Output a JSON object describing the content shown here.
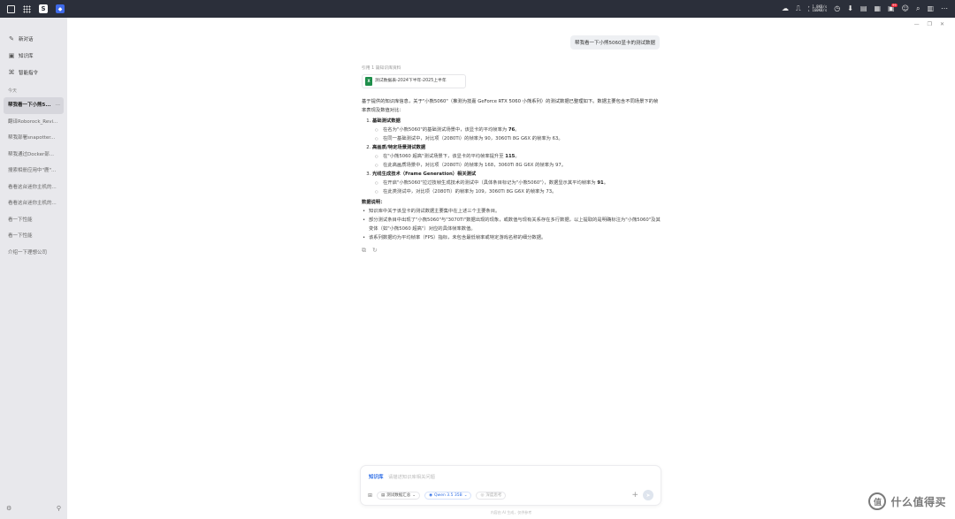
{
  "topbar": {
    "net_up": "↑ 1.8KB/s",
    "net_down": "↓ 160KB/s",
    "badge_count": "99"
  },
  "sidebar": {
    "nav": [
      {
        "label": "新对话",
        "icon": "new-chat-icon"
      },
      {
        "label": "知识库",
        "icon": "knowledge-icon"
      },
      {
        "label": "智能指令",
        "icon": "command-icon"
      }
    ],
    "section_today": "今天",
    "history": [
      {
        "label": "帮我看一下小熊5...",
        "active": true
      },
      {
        "label": "翻译Roborock_Revi..."
      },
      {
        "label": "帮我部署snapotter..."
      },
      {
        "label": "帮我通过Docker部..."
      },
      {
        "label": "搜索相册应用中\"鹿\"..."
      },
      {
        "label": "看看这台迷你主机的..."
      },
      {
        "label": "看看这台迷你主机的..."
      },
      {
        "label": "看一下性能"
      },
      {
        "label": "看一下性能"
      },
      {
        "label": "介绍一下理想公司"
      }
    ],
    "more_label": "···"
  },
  "chat": {
    "user_message": "帮我看一下小熊5060显卡的测试数据",
    "cite_label": "引用 1 篇知识库资料",
    "cite_file": "测试数据表-2024下半年-2025上半年",
    "intro": "基于提供的知识库信息，关于\"小熊5060\"（推测为技嘉 GeForce RTX 5060 小熊系列）的测试数据已整理如下。数据主要包含不同场景下的帧率表现及数值对比：",
    "sections": [
      {
        "title": "基础测试数据",
        "items": [
          {
            "pre": "在名为\"小熊5060\"的基础测试场景中，该显卡的平均帧率为 ",
            "num": "76",
            "post": "。"
          },
          {
            "pre": "在同一基础测试中，对比项（2080Ti）的帧率为 90，3060Ti 8G G6X 的帧率为 63。",
            "num": "",
            "post": ""
          }
        ]
      },
      {
        "title": "高画质/特定场景测试数据",
        "items": [
          {
            "pre": "在\"小熊5060 超高\"测试场景下，该显卡的平均帧率提升至 ",
            "num": "115",
            "post": "。"
          },
          {
            "pre": "在此高画质场景中，对比项（2080Ti）的帧率为 168，3060Ti 8G G6X 的帧率为 97。",
            "num": "",
            "post": ""
          }
        ]
      },
      {
        "title": "光线生成技术（Frame Generation）相关测试",
        "items": [
          {
            "pre": "在开启\"小熊5060\"拉过技帧生成技术的测试中（具体条目标记为\"小熊5060\"），数据显示其平均帧率为 ",
            "num": "91",
            "post": "。"
          },
          {
            "pre": "在此类测试中，对比项（2080Ti）的帧率为 109，3060Ti 8G G6X 的帧率为 73。",
            "num": "",
            "post": ""
          }
        ]
      }
    ],
    "notes_title": "数据说明：",
    "notes": [
      "知识库中关于该显卡的测试数据主要集中在上述三个主要条目。",
      "部分测试条目中出现了\"小熊5060\"与\"3070Ti\"数据出现的现象，或数值与现有关系存在多行数据，以上提取的是明确标注为\"小熊5060\"及其变体（如\"小熊5060 超高\"）对应的具体帧率数值。",
      "该系列数据均为平均帧率（FPS）指标，未包含最低帧率或特定游戏名称的细分数据。"
    ]
  },
  "input": {
    "kb_tag": "知识库",
    "placeholder": "请描述知识库相关问题",
    "file_chip": "测试数据汇总",
    "model_chip": "Qwen 3.5 35B",
    "think_chip": "深度思考",
    "disclaimer": "内容由 AI 生成，仅供参考"
  },
  "watermark": {
    "logo_char": "值",
    "text": "什么值得买"
  }
}
